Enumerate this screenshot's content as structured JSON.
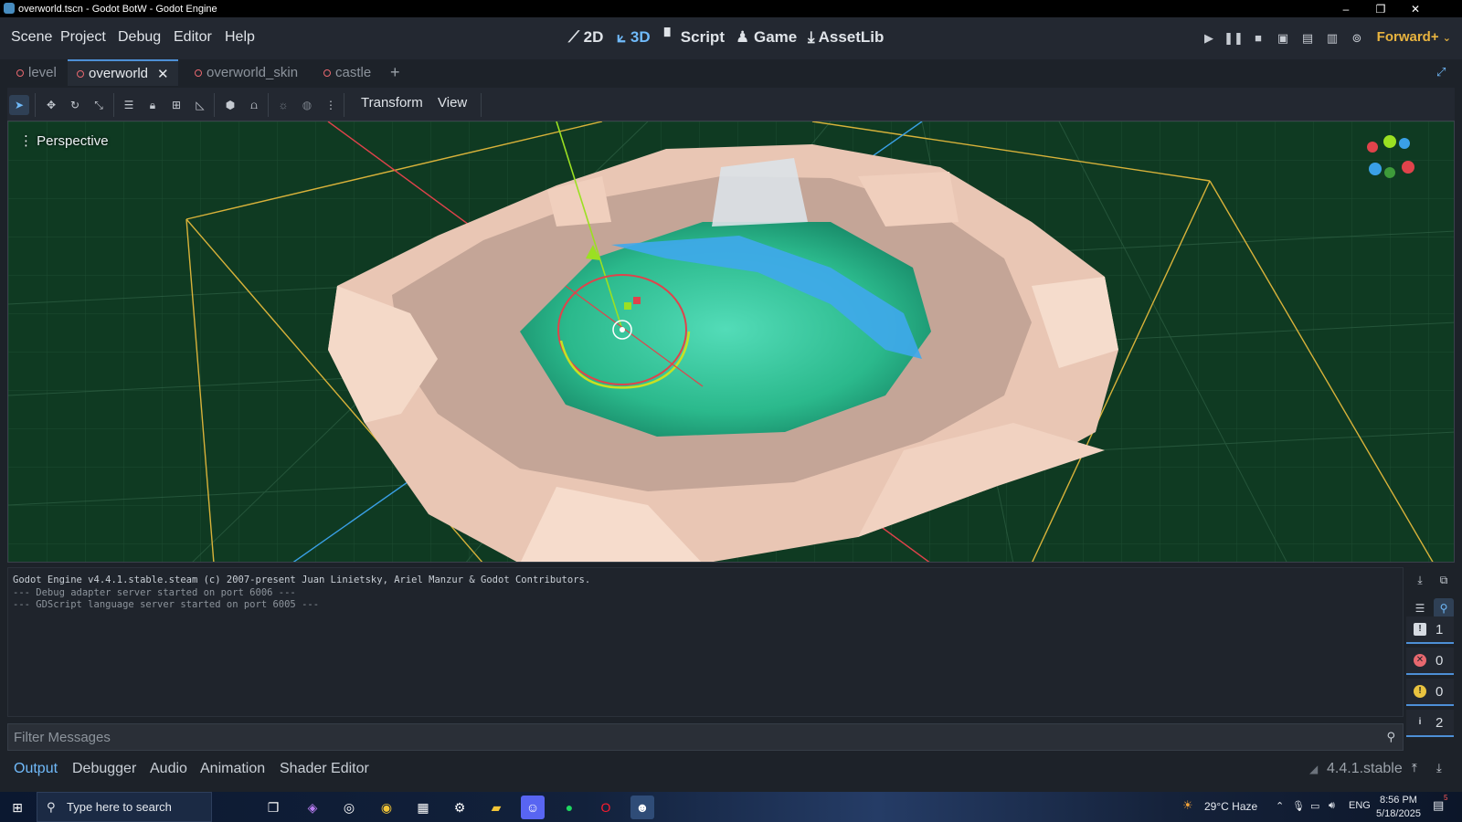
{
  "window": {
    "title": "overworld.tscn - Godot BotW - Godot Engine"
  },
  "menu": [
    "Scene",
    "Project",
    "Debug",
    "Editor",
    "Help"
  ],
  "workspaces": [
    {
      "label": "2D",
      "icon": "2d-icon"
    },
    {
      "label": "3D",
      "icon": "3d-icon",
      "active": true
    },
    {
      "label": "Script",
      "icon": "script-icon"
    },
    {
      "label": "Game",
      "icon": "game-icon"
    },
    {
      "label": "AssetLib",
      "icon": "assetlib-icon"
    }
  ],
  "renderer": "Forward+",
  "scene_tabs": [
    {
      "label": "level"
    },
    {
      "label": "overworld",
      "active": true
    },
    {
      "label": "overworld_skin"
    },
    {
      "label": "castle"
    }
  ],
  "toolbar_menus": {
    "transform": "Transform",
    "view": "View"
  },
  "viewport": {
    "label": "Perspective"
  },
  "output_lines": [
    "Godot Engine v4.4.1.stable.steam (c) 2007-present Juan Linietsky, Ariel Manzur & Godot Contributors.",
    "--- Debug adapter server started on port 6006 ---",
    "--- GDScript language server started on port 6005 ---"
  ],
  "message_counts": {
    "warnings_all": "1",
    "errors": "0",
    "warnings": "0",
    "info": "2"
  },
  "filter": {
    "placeholder": "Filter Messages"
  },
  "bottom_tabs": [
    "Output",
    "Debugger",
    "Audio",
    "Animation",
    "Shader Editor"
  ],
  "version": "4.4.1.stable",
  "taskbar": {
    "search_placeholder": "Type here to search",
    "weather": "29°C  Haze",
    "language": "ENG",
    "time": "8:56 PM",
    "date": "5/18/2025",
    "notification_count": "5"
  },
  "colors": {
    "accent": "#70bafa",
    "renderer": "#e9b43f",
    "viewport_bg": "#0f3a22"
  }
}
